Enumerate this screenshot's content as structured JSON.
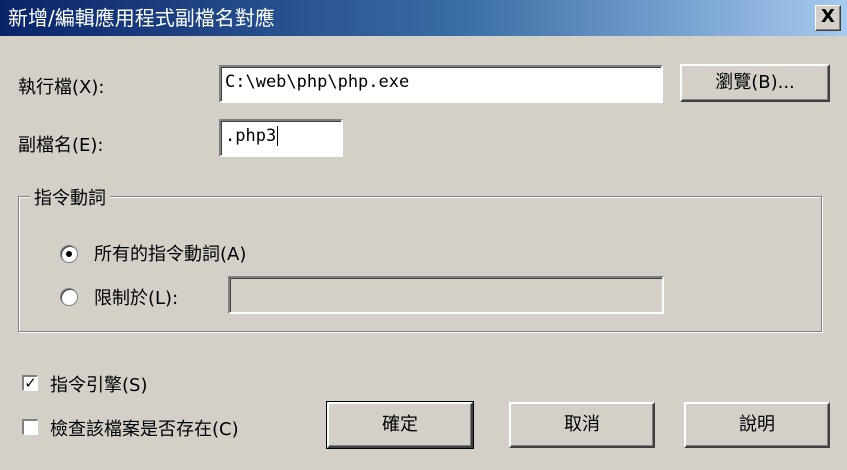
{
  "window": {
    "title": "新增/編輯應用程式副檔名對應",
    "close_glyph": "X"
  },
  "executable": {
    "label": "執行檔(X):",
    "value": "C:\\web\\php\\php.exe",
    "browse_label": "瀏覽(B)..."
  },
  "extension": {
    "label": "副檔名(E):",
    "value": ".php3"
  },
  "verbs": {
    "group_label": "指令動詞",
    "all_label": "所有的指令動詞(A)",
    "limit_label": "限制於(L):",
    "limit_value": "",
    "selected": "all"
  },
  "options": {
    "script_engine_label": "指令引擎(S)",
    "script_engine_checked": true,
    "check_file_label": "檢查該檔案是否存在(C)",
    "check_file_checked": false
  },
  "buttons": {
    "ok": "確定",
    "cancel": "取消",
    "help": "說明"
  }
}
